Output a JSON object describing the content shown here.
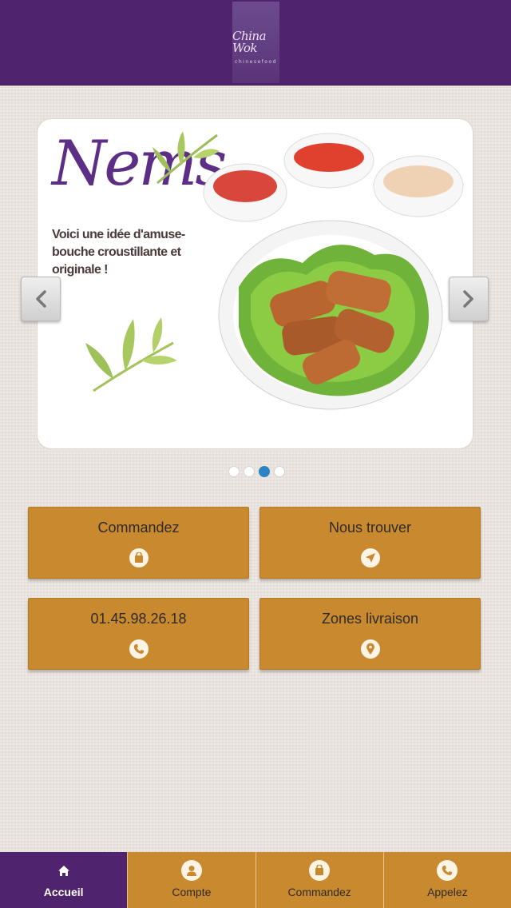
{
  "header": {
    "logo_text": "China Wok",
    "logo_subtext": "chinesefood"
  },
  "slider": {
    "title": "Nems",
    "caption": "Voici une idée d'amuse-bouche croustillante et originale !",
    "dot_count": 4,
    "active_dot": 3
  },
  "tiles": [
    {
      "label": "Commandez",
      "icon": "shopping-bag-icon"
    },
    {
      "label": "Nous trouver",
      "icon": "location-arrow-icon"
    },
    {
      "label": "01.45.98.26.18",
      "icon": "phone-icon"
    },
    {
      "label": "Zones livraison",
      "icon": "map-pin-icon"
    }
  ],
  "bottom_nav": {
    "items": [
      {
        "label": "Accueil",
        "icon": "home-icon",
        "active": true
      },
      {
        "label": "Compte",
        "icon": "user-icon",
        "active": false
      },
      {
        "label": "Commandez",
        "icon": "shopping-bag-icon",
        "active": false
      },
      {
        "label": "Appelez",
        "icon": "phone-icon",
        "active": false
      }
    ]
  },
  "colors": {
    "header": "#4f236d",
    "tile": "#c98a2f",
    "active_dot": "#2a84c4",
    "background": "#ebe4df"
  }
}
